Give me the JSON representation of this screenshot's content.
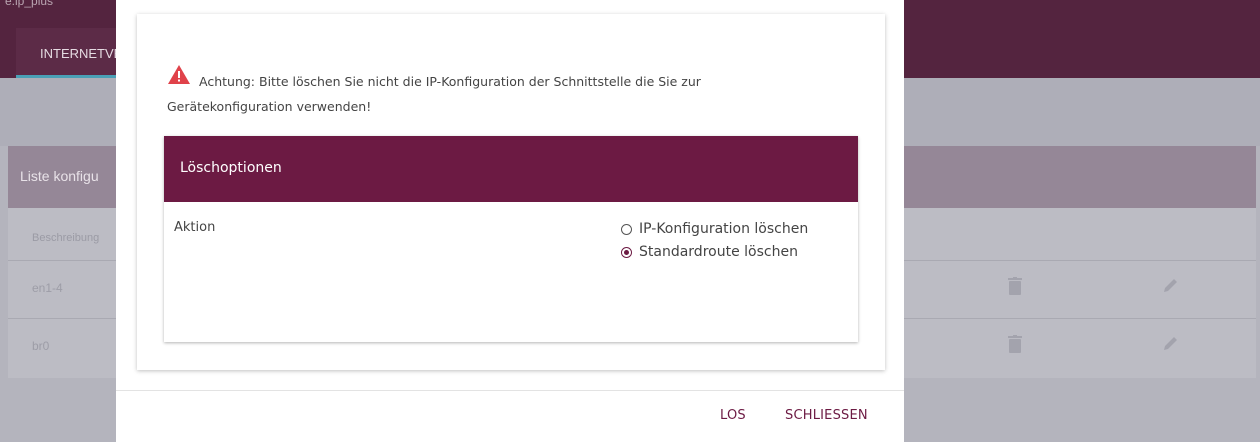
{
  "background": {
    "device_name": "e.ip_plus",
    "tab_label": "INTERNETVE",
    "list_title": "Liste konfigu",
    "column_header": "Beschreibung",
    "rows": [
      {
        "name": "en1-4"
      },
      {
        "name": "br0"
      }
    ],
    "row_icons": [
      "trash-icon",
      "pencil-icon"
    ]
  },
  "dialog": {
    "warning_icon": "warning-triangle-icon",
    "warning_line1": "Achtung: Bitte löschen Sie nicht die IP-Konfiguration der Schnittstelle die Sie zur",
    "warning_line2": "Gerätekonfiguration verwenden!",
    "card_title": "Löschoptionen",
    "field_label": "Aktion",
    "options": [
      {
        "label": "IP-Konfiguration löschen",
        "selected": false
      },
      {
        "label": "Standardroute löschen",
        "selected": true
      }
    ],
    "buttons": {
      "go": "LOS",
      "close": "SCHLIESSEN"
    }
  },
  "colors": {
    "brand": "#6c1a43",
    "header": "#54243f",
    "warning": "#e0424a"
  }
}
